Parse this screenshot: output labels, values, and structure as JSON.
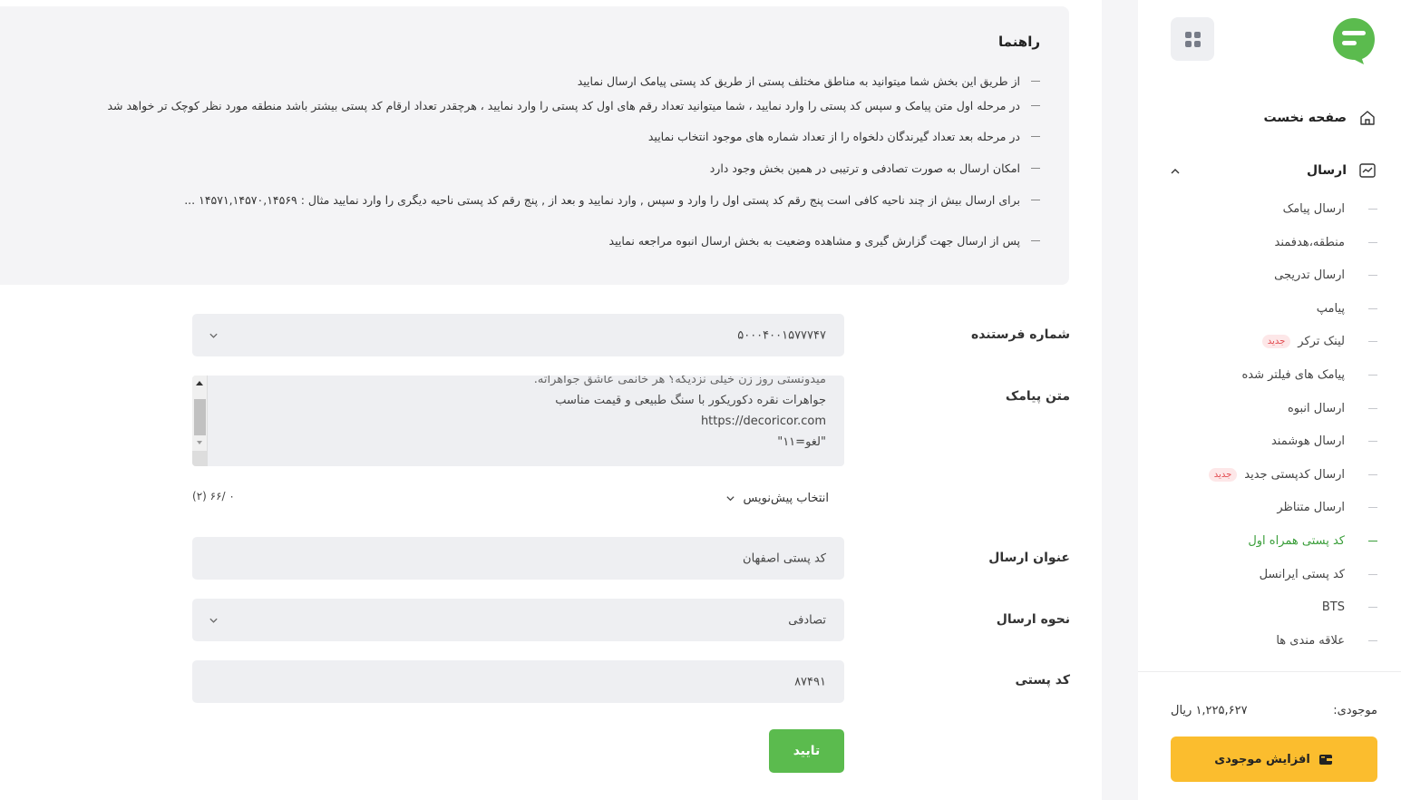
{
  "sidebar": {
    "home_label": "صفحه نخست",
    "send_label": "ارسال",
    "new_badge": "جدید",
    "items": [
      {
        "label": "ارسال پیامک"
      },
      {
        "label": "منطقه،هدفمند"
      },
      {
        "label": "ارسال تدریجی"
      },
      {
        "label": "پیامپ"
      },
      {
        "label": "لینک ترکر"
      },
      {
        "label": "پیامک های فیلتر شده"
      },
      {
        "label": "ارسال انبوه"
      },
      {
        "label": "ارسال هوشمند"
      },
      {
        "label": "ارسال کدپستی جدید"
      },
      {
        "label": "ارسال متناظر"
      },
      {
        "label": "کد پستی همراه اول"
      },
      {
        "label": "کد پستی ایرانسل"
      },
      {
        "label": "BTS"
      },
      {
        "label": "علاقه مندی ها"
      }
    ],
    "balance_label": "موجودی:",
    "balance_value": "۱,۲۲۵,۶۲۷ ریال",
    "topup_label": "افزایش موجودی"
  },
  "guide": {
    "title": "راهنما",
    "items": [
      "از طریق این بخش شما میتوانید به مناطق مختلف پستی از طریق کد پستی پیامک ارسال نمایید",
      "در مرحله اول متن پیامک و سپس کد پستی را وارد نمایید ، شما میتوانید تعداد رقم های اول کد پستی را وارد نمایید ، هرچقدر تعداد ارقام کد پستی بیشتر باشد منطقه مورد نظر کوچک تر خواهد شد",
      "در مرحله بعد تعداد گیرندگان دلخواه را از تعداد شماره های موجود انتخاب نمایید",
      "امکان ارسال به صورت تصادفی و ترتیبی در همین بخش وجود دارد",
      "برای ارسال بیش از چند ناحیه کافی است پنج رقم کد پستی اول را وارد و سپس , وارد نمایید و بعد از , پنج رقم کد پستی ناحیه دیگری را وارد نمایید مثال : ۱۴۵۷۱,۱۴۵۷۰,۱۴۵۶۹ ...",
      "پس از ارسال جهت گزارش گیری و مشاهده وضعیت به بخش ارسال انبوه مراجعه نمایید"
    ]
  },
  "form": {
    "sender_label": "شماره فرستنده",
    "sender_value": "۵۰۰۰۴۰۰۱۵۷۷۷۴۷",
    "message_label": "متن پیامک",
    "message_lines": [
      "میدونستی روز زن خیلی نزدیکه؟ هر خانمی عاشق جواهراته.",
      "جواهرات نقره دکوریکور با سنگ طبیعی و قیمت مناسب",
      "https://decoricor.com",
      "\"لغو=۱۱\""
    ],
    "draft_label": "انتخاب پیش‌نویس",
    "counter": "۰ /۶۶ (۲)",
    "title_label": "عنوان ارسال",
    "title_value": "کد پستی اصفهان",
    "method_label": "نحوه ارسال",
    "method_value": "تصادفی",
    "postal_label": "کد پستی",
    "postal_value": "۸۷۴۹۱",
    "submit_label": "تایید"
  },
  "colors": {
    "accent_green": "#5bbb4e",
    "topup_yellow": "#fbbd2e",
    "badge_red": "#e24a4f"
  }
}
